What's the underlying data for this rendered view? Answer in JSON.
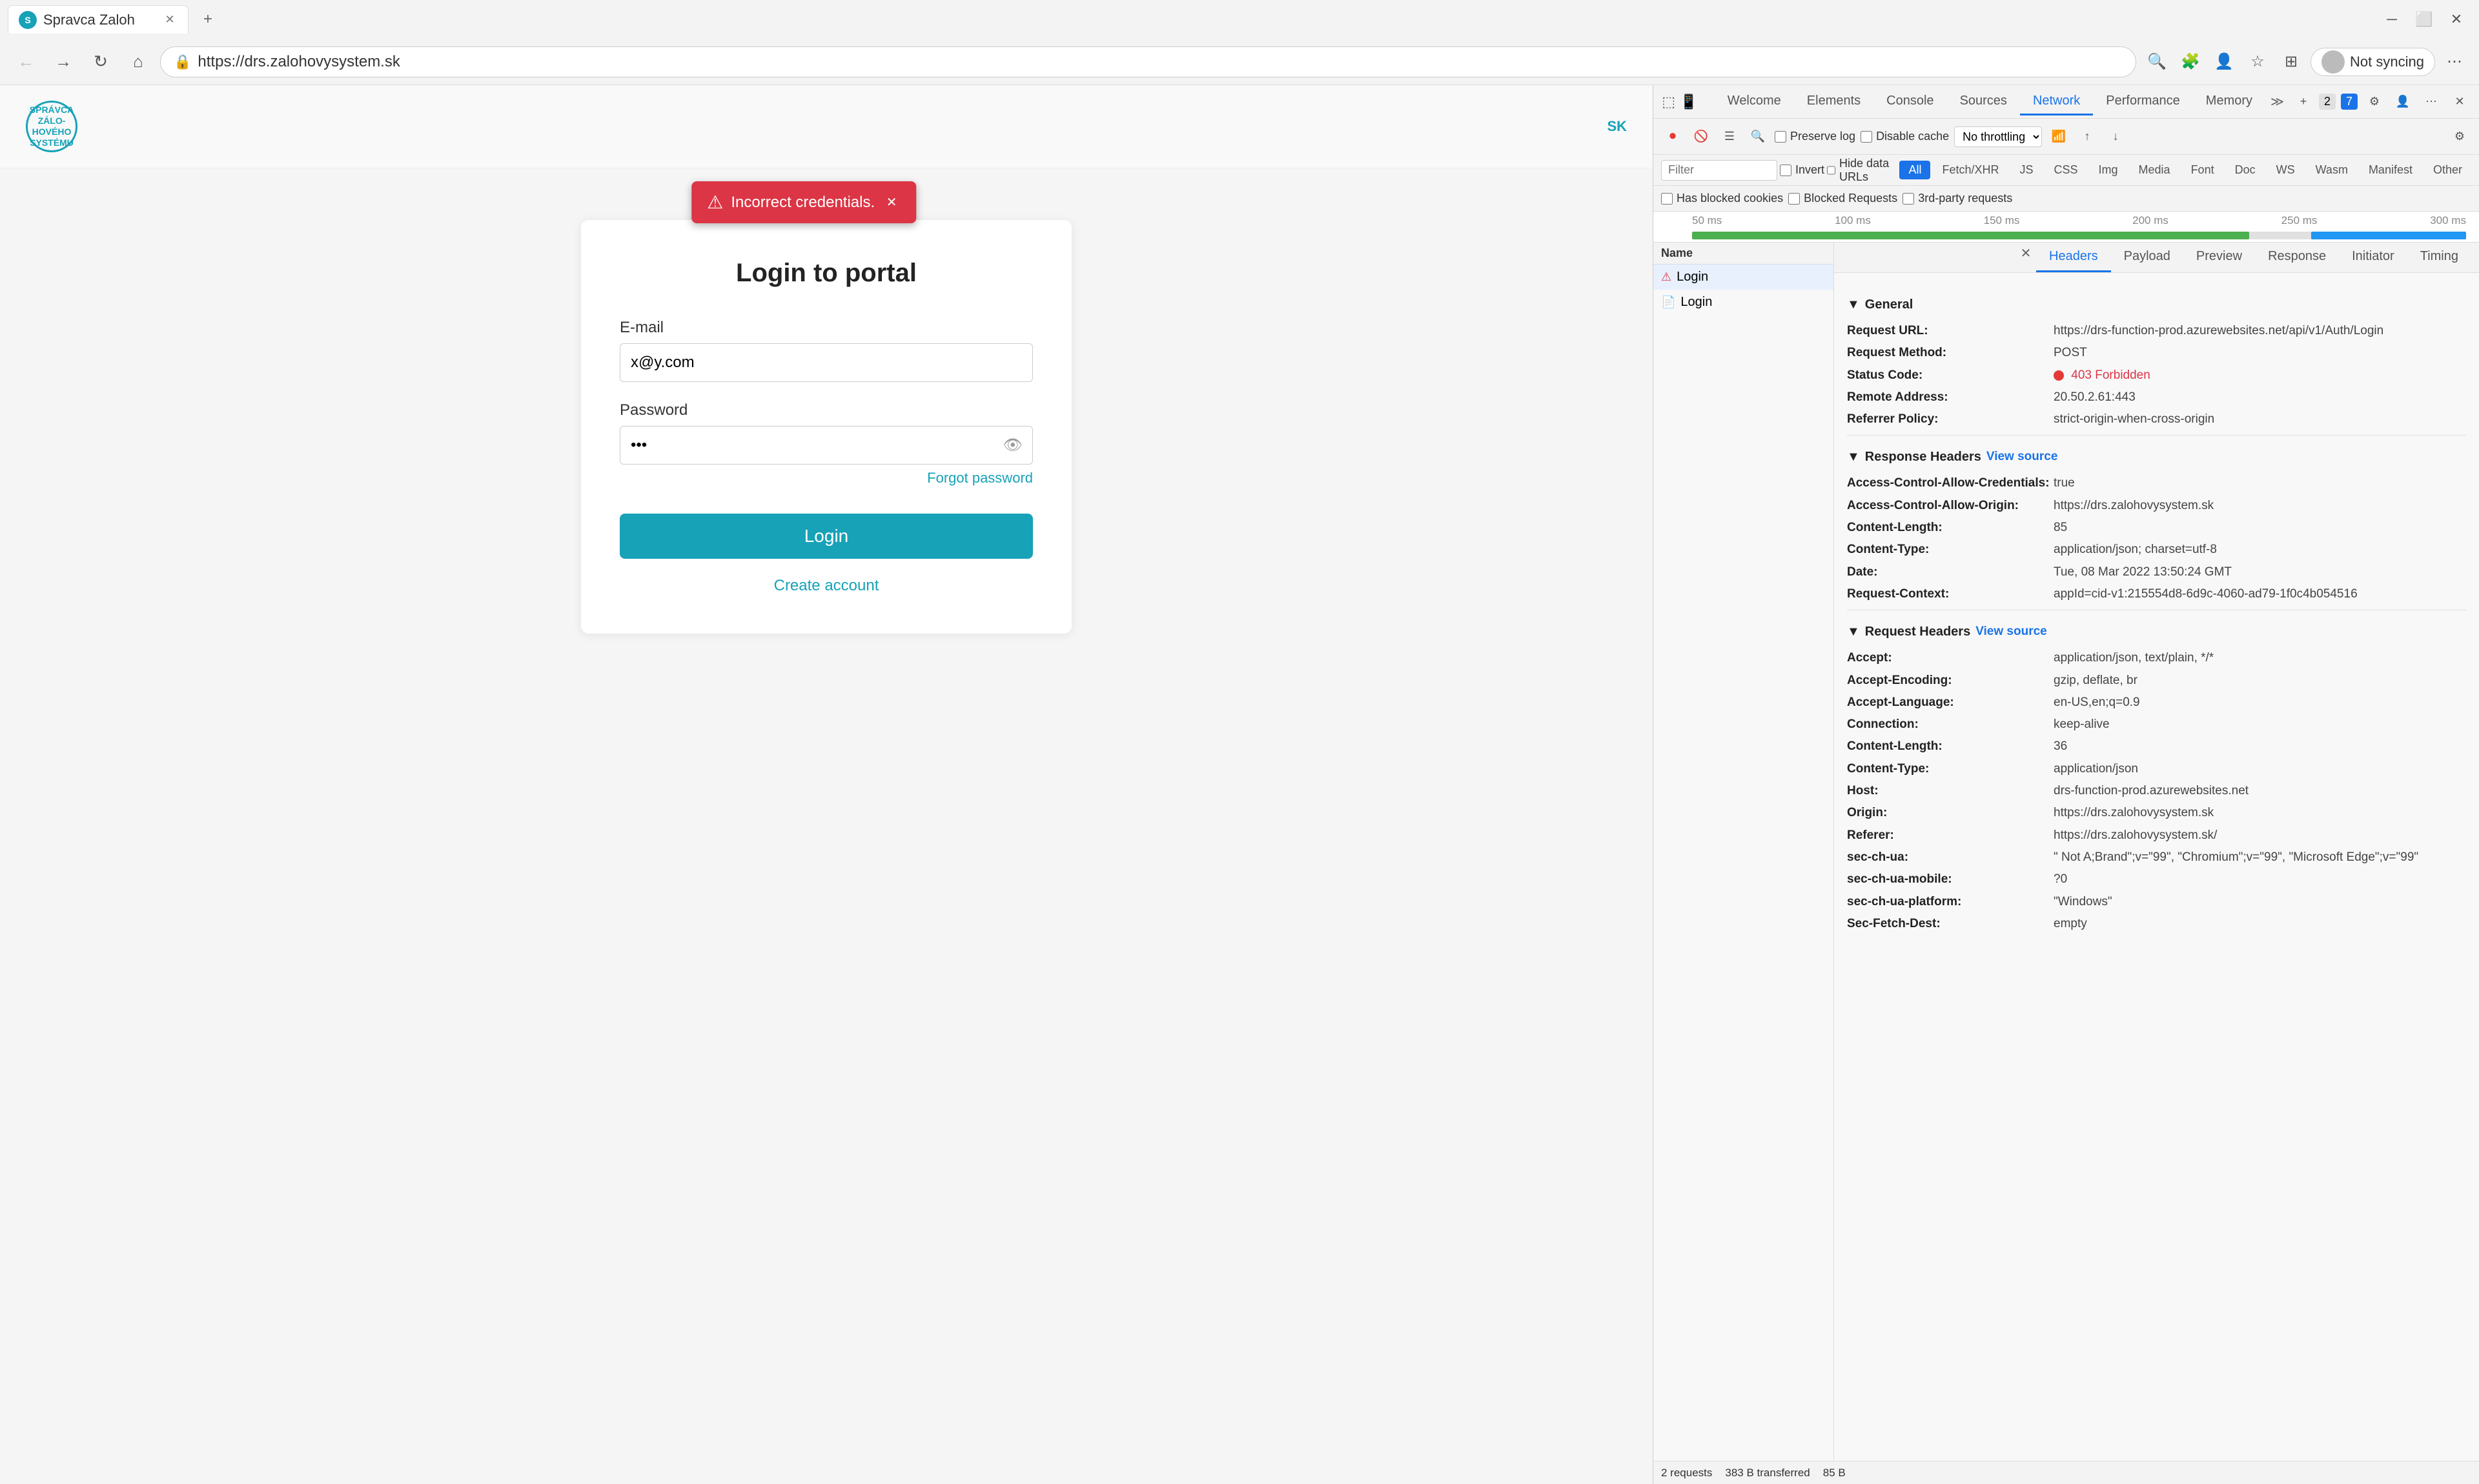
{
  "browser": {
    "tab_title": "Spravca Zaloh",
    "url": "https://drs.zalohovysystem.sk",
    "new_tab_label": "+",
    "sync_label": "Not syncing",
    "more_label": "⋯"
  },
  "nav": {
    "back": "←",
    "forward": "→",
    "refresh": "↻",
    "home": "⌂",
    "search_icon": "🔍",
    "favorites": "★",
    "collections": "⊞",
    "profile": "👤"
  },
  "page": {
    "logo_text": "SPRÁVCA\nZÁLOHOVÉHO\nSYSTÉMU",
    "lang": "SK",
    "error_message": "Incorrect credentials.",
    "login_title": "Login to portal",
    "email_label": "E-mail",
    "email_value": "x@y.com",
    "password_label": "Password",
    "password_value": "•••",
    "forgot_password": "Forgot password",
    "login_button": "Login",
    "create_account": "Create account"
  },
  "devtools": {
    "tabs": [
      "Welcome",
      "Elements",
      "Console",
      "Sources",
      "Network",
      "Performance",
      "Memory"
    ],
    "active_tab": "Network",
    "controls": {
      "record_icon": "⏺",
      "clear_icon": "🚫",
      "filter_icon": "☰",
      "search_icon": "🔍",
      "preserve_log": "Preserve log",
      "disable_cache": "Disable cache",
      "throttle": "No throttling",
      "offline_icon": "📶",
      "upload_icon": "↑",
      "download_icon": "↓"
    },
    "filter_types": [
      "All",
      "Fetch/XHR",
      "JS",
      "CSS",
      "Img",
      "Media",
      "Font",
      "Doc",
      "WS",
      "Wasm",
      "Manifest",
      "Other"
    ],
    "active_filter": "All",
    "filter_checkboxes": {
      "invert": "Invert",
      "hide_data_urls": "Hide data URLs",
      "has_blocked_cookies": "Has blocked cookies",
      "blocked_requests": "Blocked Requests",
      "third_party": "3rd-party requests"
    },
    "timeline_labels": [
      "50 ms",
      "100 ms",
      "150 ms",
      "200 ms",
      "250 ms",
      "300 ms"
    ],
    "requests": [
      {
        "name": "Login",
        "selected": true,
        "error": true
      },
      {
        "name": "Login",
        "selected": false,
        "error": false
      }
    ],
    "request_detail": {
      "tabs": [
        "Headers",
        "Payload",
        "Preview",
        "Response",
        "Initiator",
        "Timing"
      ],
      "active_tab": "Headers",
      "general_section": "General",
      "request_url_label": "Request URL:",
      "request_url_value": "https://drs-function-prod.azurewebsites.net/api/v1/Auth/Login",
      "request_method_label": "Request Method:",
      "request_method_value": "POST",
      "status_code_label": "Status Code:",
      "status_code_value": "403 Forbidden",
      "remote_address_label": "Remote Address:",
      "remote_address_value": "20.50.2.61:443",
      "referrer_policy_label": "Referrer Policy:",
      "referrer_policy_value": "strict-origin-when-cross-origin",
      "response_headers_label": "Response Headers",
      "view_source": "View source",
      "response_headers": [
        {
          "name": "Access-Control-Allow-Credentials:",
          "value": "true"
        },
        {
          "name": "Access-Control-Allow-Origin:",
          "value": "https://drs.zalohovysystem.sk"
        },
        {
          "name": "Content-Length:",
          "value": "85"
        },
        {
          "name": "Content-Type:",
          "value": "application/json; charset=utf-8"
        },
        {
          "name": "Date:",
          "value": "Tue, 08 Mar 2022 13:50:24 GMT"
        },
        {
          "name": "Request-Context:",
          "value": "appId=cid-v1:215554d8-6d9c-4060-ad79-1f0c4b054516"
        }
      ],
      "request_headers_label": "Request Headers",
      "request_headers": [
        {
          "name": "Accept:",
          "value": "application/json, text/plain, */*"
        },
        {
          "name": "Accept-Encoding:",
          "value": "gzip, deflate, br"
        },
        {
          "name": "Accept-Language:",
          "value": "en-US,en;q=0.9"
        },
        {
          "name": "Connection:",
          "value": "keep-alive"
        },
        {
          "name": "Content-Length:",
          "value": "36"
        },
        {
          "name": "Content-Type:",
          "value": "application/json"
        },
        {
          "name": "Host:",
          "value": "drs-function-prod.azurewebsites.net"
        },
        {
          "name": "Origin:",
          "value": "https://drs.zalohovysystem.sk"
        },
        {
          "name": "Referer:",
          "value": "https://drs.zalohovysystem.sk/"
        },
        {
          "name": "sec-ch-ua:",
          "value": "\" Not A;Brand\";v=\"99\", \"Chromium\";v=\"99\", \"Microsoft Edge\";v=\"99\""
        },
        {
          "name": "sec-ch-ua-mobile:",
          "value": "?0"
        },
        {
          "name": "sec-ch-ua-platform:",
          "value": "\"Windows\""
        },
        {
          "name": "Sec-Fetch-Dest:",
          "value": "empty"
        }
      ]
    },
    "status_bar": {
      "requests": "2 requests",
      "transferred": "383 B transferred",
      "size": "85 B"
    },
    "badge_blue": "7",
    "badge_gray": "2"
  }
}
